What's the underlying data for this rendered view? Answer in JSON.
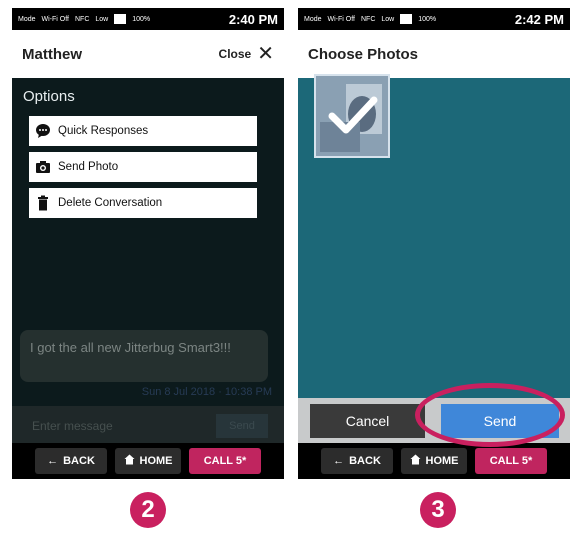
{
  "colors": {
    "accent": "#c9205f",
    "send_blue": "#3f87d9",
    "photo_bg": "#1c6878",
    "dark_bg": "#0c1a1c"
  },
  "left": {
    "status": {
      "mode": "Mode",
      "wifi": "Wi-Fi Off",
      "nfc": "NFC",
      "volume": "Low",
      "battery": "100%",
      "time": "2:40 PM"
    },
    "title": "Matthew",
    "close_label": "Close",
    "options_title": "Options",
    "options": [
      {
        "label": "Quick Responses",
        "icon": "speech-bubble-icon"
      },
      {
        "label": "Send Photo",
        "icon": "camera-icon"
      },
      {
        "label": "Delete Conversation",
        "icon": "trash-icon"
      }
    ],
    "message_text": "I got the all new Jitterbug Smart3!!!",
    "message_time": "Sun 8 Jul 2018 · 10:38 PM",
    "composer_placeholder": "Enter message",
    "composer_send": "Send",
    "nav": {
      "back": "BACK",
      "home": "HOME",
      "call": "CALL 5*"
    }
  },
  "right": {
    "status": {
      "mode": "Mode",
      "wifi": "Wi-Fi Off",
      "nfc": "NFC",
      "volume": "Low",
      "battery": "100%",
      "time": "2:42 PM"
    },
    "title": "Choose Photos",
    "cancel": "Cancel",
    "send": "Send",
    "nav": {
      "back": "BACK",
      "home": "HOME",
      "call": "CALL 5*"
    }
  },
  "steps": [
    "2",
    "3"
  ]
}
